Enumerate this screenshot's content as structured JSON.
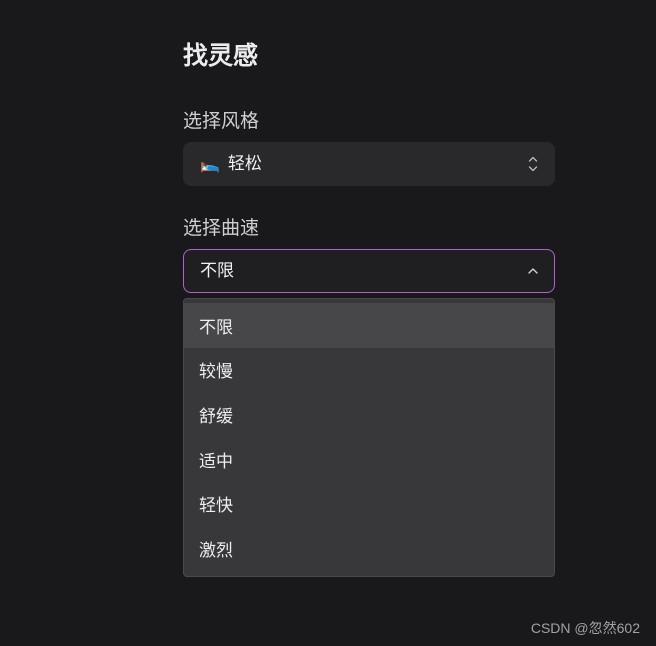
{
  "title": "找灵感",
  "style_field": {
    "label": "选择风格",
    "selected_emoji": "🛌",
    "selected_value": "轻松",
    "icon": "chevron-up-down-icon"
  },
  "speed_field": {
    "label": "选择曲速",
    "selected_value": "不限",
    "icon": "chevron-up-icon",
    "options": [
      "不限",
      "较慢",
      "舒缓",
      "适中",
      "轻快",
      "激烈"
    ],
    "highlighted_option": "不限"
  },
  "watermark": "CSDN @忽然602",
  "colors": {
    "background": "#19191b",
    "focus_border": "#b061d4",
    "dropdown_bg": "#38383b",
    "dropdown_highlight": "#474749"
  }
}
